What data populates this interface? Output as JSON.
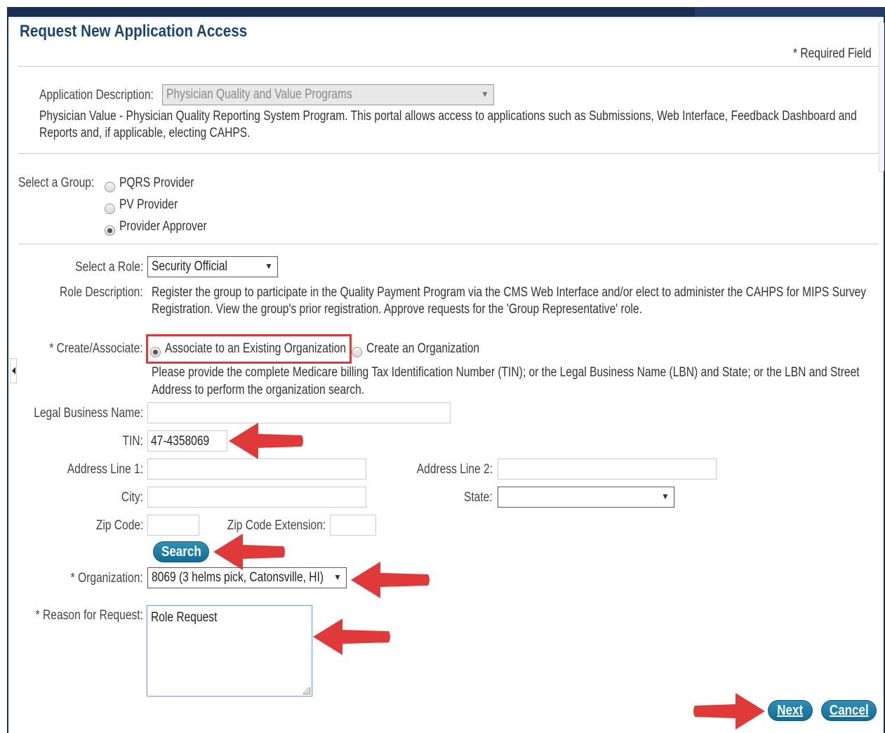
{
  "page": {
    "title": "Request New Application Access",
    "required_note": "* Required Field"
  },
  "application": {
    "label": "Application Description:",
    "selected": "Physician Quality and Value Programs",
    "description_line1": "Physician Value - Physician Quality Reporting System Program. This portal allows access to applications such as Submissions, Web Interface, Feedback Dashboard and",
    "description_line2": "Reports and, if applicable, electing CAHPS."
  },
  "group": {
    "label": "Select a Group:",
    "options": [
      "PQRS Provider",
      "PV Provider",
      "Provider Approver"
    ],
    "selected": "Provider Approver"
  },
  "role": {
    "label": "Select a Role:",
    "selected": "Security Official",
    "desc_label": "Role Description:",
    "desc_line1": "Register the group to participate in the Quality Payment Program via the CMS Web Interface and/or elect to administer the CAHPS for MIPS Survey",
    "desc_line2": "Registration. View the group's prior registration. Approve requests for the 'Group Representative' role."
  },
  "create_associate": {
    "label": "* Create/Associate:",
    "option_associate": "Associate to an Existing Organization",
    "option_create": "Create an Organization",
    "selected": "Associate to an Existing Organization",
    "help_line1": "Please provide the complete Medicare billing Tax Identification Number (TIN); or the Legal Business Name (LBN) and State; or the LBN and Street",
    "help_line2": "Address to perform the organization search."
  },
  "fields": {
    "legal_business_name_label": "Legal Business Name:",
    "legal_business_name_value": "",
    "tin_label": "TIN:",
    "tin_value": "47-4358069",
    "address1_label": "Address Line 1:",
    "address1_value": "",
    "address2_label": "Address Line 2:",
    "address2_value": "",
    "city_label": "City:",
    "city_value": "",
    "state_label": "State:",
    "state_value": "",
    "zip_label": "Zip Code:",
    "zip_value": "",
    "zip_ext_label": "Zip Code Extension:",
    "zip_ext_value": ""
  },
  "search_button": "Search",
  "organization": {
    "label": "* Organization:",
    "selected": "8069 (3 helms pick, Catonsville, HI)"
  },
  "reason": {
    "label": "* Reason for Request:",
    "value": "Role Request"
  },
  "actions": {
    "next": "Next",
    "cancel": "Cancel"
  },
  "colors": {
    "title": "#19466e",
    "button": "#136d95",
    "annotation_red": "#e0393a"
  }
}
